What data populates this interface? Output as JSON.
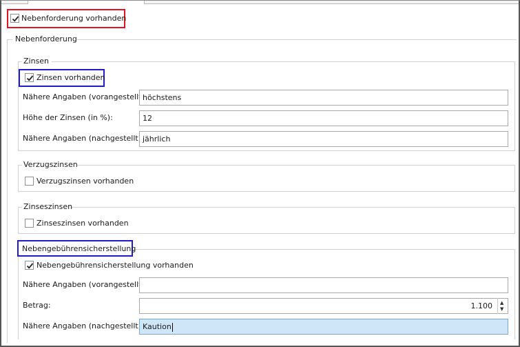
{
  "main": {
    "checked": true,
    "label": "Nebenforderung vorhanden",
    "group_title": "Nebenforderung"
  },
  "zinsen": {
    "title": "Zinsen",
    "checkbox": {
      "checked": true,
      "label": "Zinsen vorhanden"
    },
    "fields": [
      {
        "label": "Nähere Angaben (vorangestellt):",
        "value": "höchstens"
      },
      {
        "label": "Höhe der Zinsen (in %):",
        "value": "12"
      },
      {
        "label": "Nähere Angaben (nachgestellt):",
        "value": "jährlich"
      }
    ]
  },
  "verzugszinsen": {
    "title": "Verzugszinsen",
    "checkbox": {
      "checked": false,
      "label": "Verzugszinsen vorhanden"
    }
  },
  "zinseszinsen": {
    "title": "Zinseszinsen",
    "checkbox": {
      "checked": false,
      "label": "Zinseszinsen vorhanden"
    }
  },
  "nebengebuehren": {
    "title": "Nebengebührensicherstellung",
    "checkbox": {
      "checked": true,
      "label": "Nebengebührensicherstellung vorhanden"
    },
    "fields": [
      {
        "label": "Nähere Angaben (vorangestellt):",
        "value": ""
      },
      {
        "label": "Betrag:",
        "value": "1.100"
      },
      {
        "label": "Nähere Angaben (nachgestellt):",
        "value": "Kaution"
      }
    ]
  },
  "icons": {
    "check": "checkmark-icon",
    "spin_up": "chevron-up-icon",
    "spin_down": "chevron-down-icon"
  },
  "colors": {
    "highlight_red": "#e0141e",
    "highlight_blue": "#1c1cc8",
    "focus_field": "#cfe6f8"
  }
}
